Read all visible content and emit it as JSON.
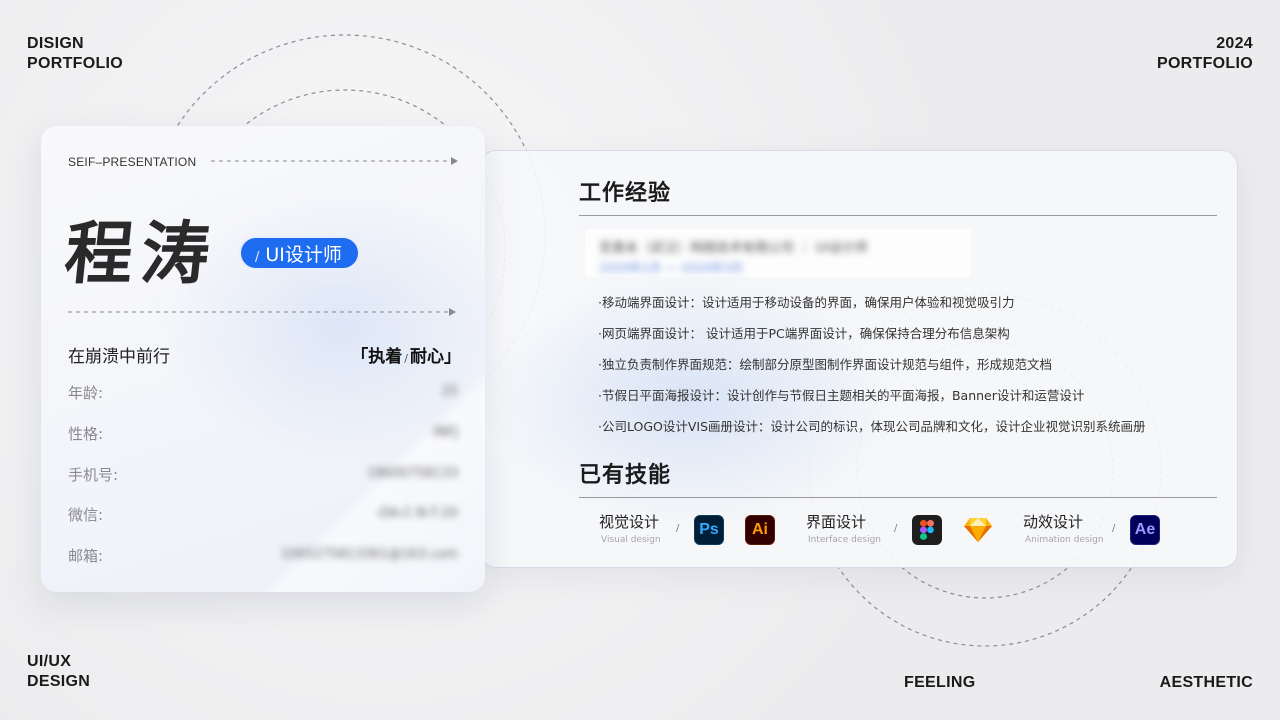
{
  "corners": {
    "top_left": [
      "DISIGN",
      "PORTFOLIO"
    ],
    "top_right": [
      "2024",
      "PORTFOLIO"
    ],
    "bottom_left": [
      "UI/UX",
      "DESIGN"
    ],
    "bottom_center": "FEELING",
    "bottom_right": "AESTHETIC"
  },
  "profile": {
    "section_label": "SEIF–PRESENTATION",
    "name": "程涛",
    "role_slash": "/",
    "role": "UI设计师",
    "motto": "在崩溃中前行",
    "traits_open": "「",
    "trait_1": "执着",
    "trait_sep": "/",
    "trait_2": "耐心",
    "traits_close": "」",
    "info": [
      {
        "label": "年龄:",
        "value": "25"
      },
      {
        "label": "性格:",
        "value": "INFJ"
      },
      {
        "label": "手机号:",
        "value": "18600758133"
      },
      {
        "label": "微信:",
        "value": "-DA-C-N-T-20"
      },
      {
        "label": "邮箱:",
        "value": "1065275813361@163.com"
      }
    ]
  },
  "experience": {
    "title": "工作经验",
    "company_line": "至善未（武汉）网络技术有限公司 ｜ UI设计师",
    "date_line": "2020年1月 — 2024年3月",
    "duties": [
      "·移动端界面设计：设计适用于移动设备的界面，确保用户体验和视觉吸引力",
      "·网页端界面设计：  设计适用于PC端界面设计，确保保持合理分布信息架构",
      "·独立负责制作界面规范：绘制部分原型图制作界面设计规范与组件，形成规范文档",
      "·节假日平面海报设计：设计创作与节假日主题相关的平面海报，Banner设计和运营设计",
      "·公司LOGO设计VIS画册设计：设计公司的标识，体现公司品牌和文化，设计企业视觉识别系统画册"
    ]
  },
  "skills": {
    "title": "已有技能",
    "groups": [
      {
        "name": "视觉设计",
        "en": "Visual design"
      },
      {
        "name": "界面设计",
        "en": "Interface design"
      },
      {
        "name": "动效设计",
        "en": "Animation design"
      }
    ],
    "slash": "/",
    "icons": {
      "ps": "Ps",
      "ai": "Ai",
      "ae": "Ae",
      "figma": "figma-icon",
      "sketch": "sketch-icon"
    },
    "colors": {
      "ps_bg": "#001e36",
      "ps_fg": "#31a8ff",
      "ai_bg": "#330000",
      "ai_fg": "#ff9a00",
      "ae_bg": "#00005b",
      "ae_fg": "#9999ff"
    }
  },
  "accent_color": "#1e6cf0"
}
